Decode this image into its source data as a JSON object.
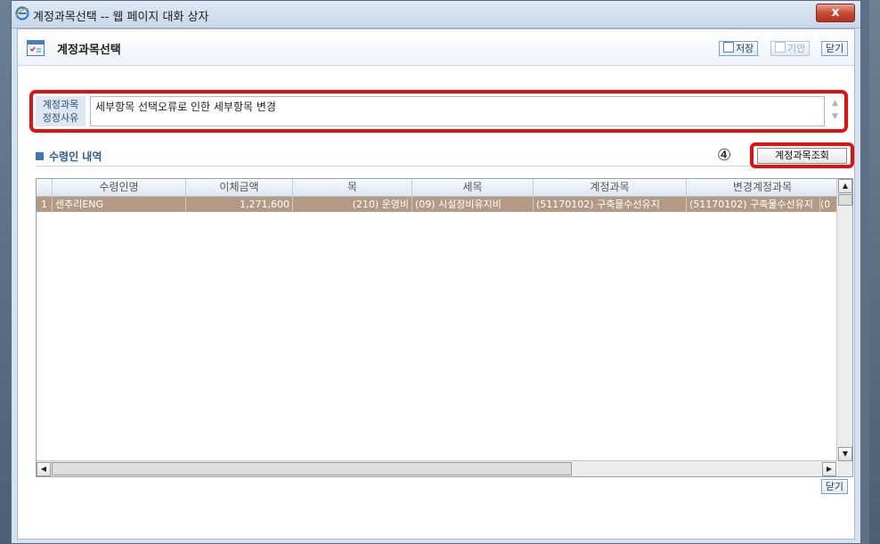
{
  "window": {
    "title": "계정과목선택 -- 웹 페이지 대화 상자",
    "close_glyph": "x"
  },
  "header": {
    "page_title": "계정과목선택",
    "buttons": {
      "save": "저장",
      "draft": "기안",
      "close": "닫기"
    }
  },
  "reason": {
    "label_line1": "계정과목",
    "label_line2": "정정사유",
    "text": "세부항목 선택오류로 인한 세부항목 변경"
  },
  "section": {
    "title": "수령인 내역",
    "step_marker": "④",
    "lookup_button": "계정과목조회"
  },
  "grid": {
    "columns": [
      "수령인명",
      "이체금액",
      "목",
      "세목",
      "계정과목",
      "변경계정과목"
    ],
    "rows": [
      {
        "num": "1",
        "recipient": "센추리ENG",
        "amount": "1,271,600",
        "item": "(210) 운영비",
        "sub_item": "(09) 시설장비유지비",
        "account": "(51170102) 구축물수선유지",
        "changed_account": "(51170102) 구축물수선유지",
        "overflow": "(0"
      }
    ]
  },
  "footer": {
    "close": "닫기"
  },
  "colors": {
    "highlight_red": "#e41010",
    "selected_row": "#b49a84",
    "section_blue": "#2a5e96"
  }
}
